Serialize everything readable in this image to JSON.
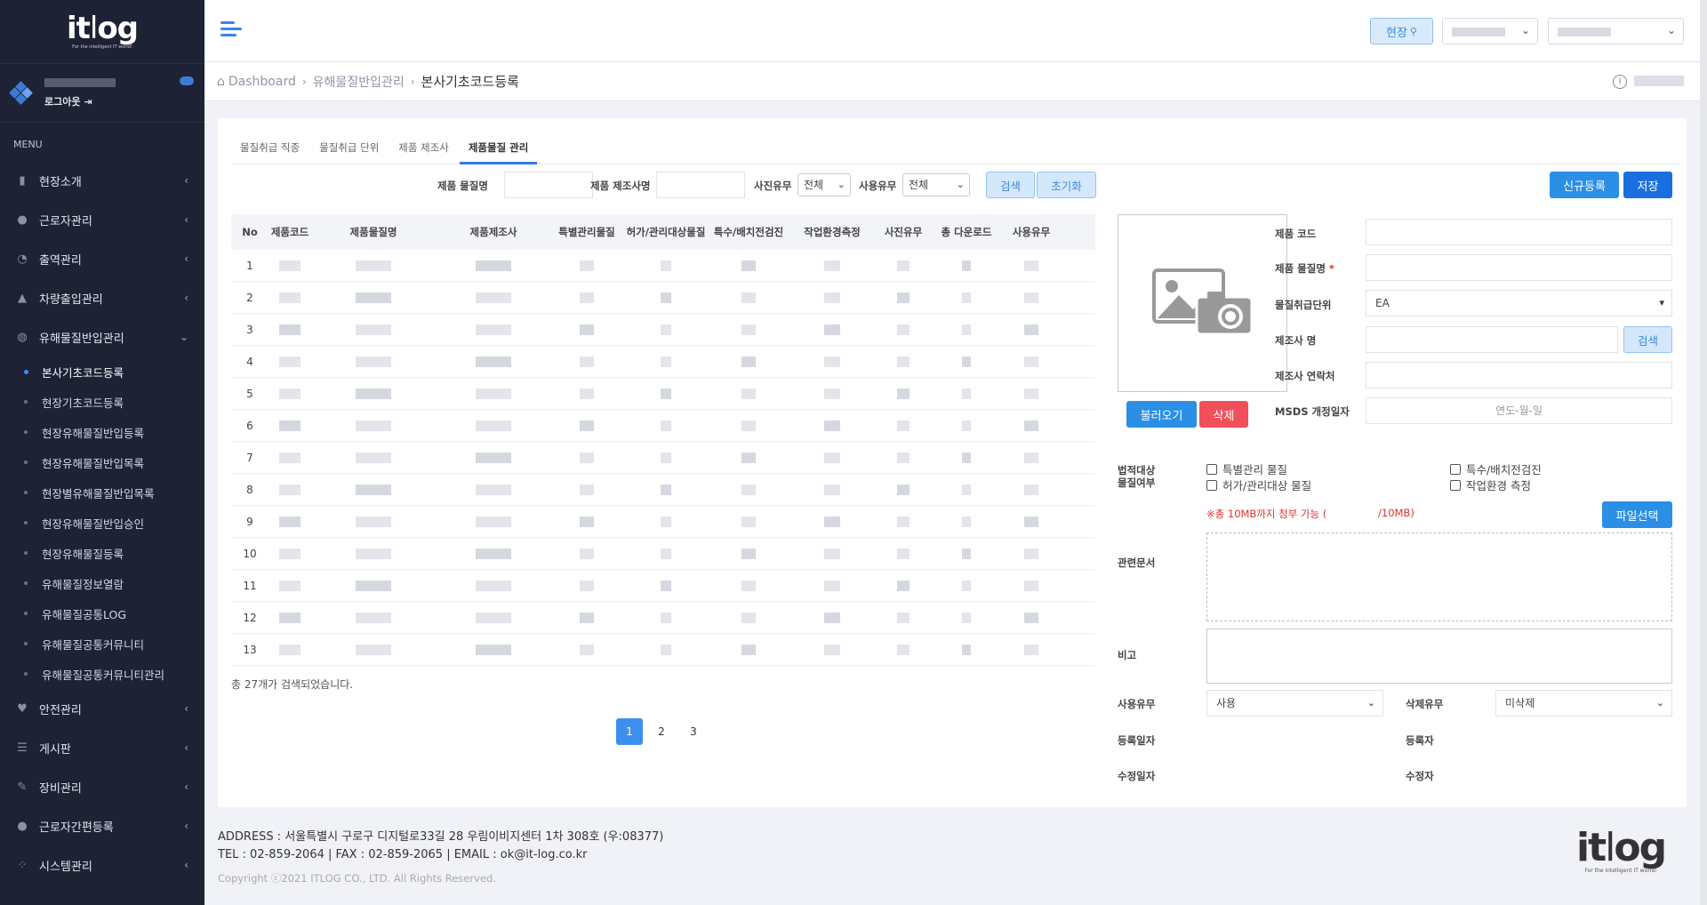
{
  "logo": {
    "main": "itlog",
    "sub": "For the intelligent IT world!"
  },
  "sidebar": {
    "logout": "로그아웃",
    "menu_head": "MENU",
    "items": [
      {
        "label": "현장소개",
        "icon": "building-icon"
      },
      {
        "label": "근로자관리",
        "icon": "user-icon"
      },
      {
        "label": "출역관리",
        "icon": "pie-icon"
      },
      {
        "label": "차량출입관리",
        "icon": "graduation-icon"
      },
      {
        "label": "유해물질반입관리",
        "icon": "flask-icon"
      }
    ],
    "sub_items": [
      "본사기초코드등록",
      "현장기초코드등록",
      "현장유해물질반입등록",
      "현장유해물질반입목록",
      "현장별유해물질반입목록",
      "현장유해물질반입승인",
      "현장유해물질등록",
      "유해물질정보열람",
      "유해물질공통LOG",
      "유해물질공통커뮤니티",
      "유해물질공통커뮤니티관리"
    ],
    "items_after": [
      {
        "label": "안전관리",
        "icon": "heart-icon"
      },
      {
        "label": "게시판",
        "icon": "list-icon"
      },
      {
        "label": "장비관리",
        "icon": "wrench-icon"
      },
      {
        "label": "근로자간편등록",
        "icon": "users-icon"
      },
      {
        "label": "시스템관리",
        "icon": "nodes-icon"
      }
    ]
  },
  "topbar": {
    "site_button": "현장"
  },
  "breadcrumb": {
    "home": "Dashboard",
    "parent": "유해물질반입관리",
    "current": "본사기초코드등록"
  },
  "tabs": [
    "물질취급 직종",
    "물질취급 단위",
    "제품 제조사",
    "제품물질 관리"
  ],
  "filter": {
    "product_name_label": "제품 물질명",
    "maker_label": "제품 제조사명",
    "photo_label": "사진유무",
    "photo_value": "전체",
    "use_label": "사용유무",
    "use_value": "전체",
    "search_btn": "검색",
    "reset_btn": "초기화"
  },
  "actions": {
    "new_btn": "신규등록",
    "save_btn": "저장"
  },
  "table": {
    "headers": [
      "No",
      "제품코드",
      "제품물질명",
      "제품제조사",
      "특별관리물질",
      "허가/관리대상물질",
      "특수/배치전검진",
      "작업환경측정",
      "사진유무",
      "총 다운로드",
      "사용유무"
    ],
    "rows": [
      "1",
      "2",
      "3",
      "4",
      "5",
      "6",
      "7",
      "8",
      "9",
      "10",
      "11",
      "12",
      "13"
    ],
    "count_text": "총 27개가 검색되었습니다."
  },
  "pagination": [
    "1",
    "2",
    "3"
  ],
  "form": {
    "load_btn": "불러오기",
    "delete_btn": "삭제",
    "code_label": "제품 코드",
    "name_label": "제품 물질명",
    "req_mark": "*",
    "unit_label": "물질취급단위",
    "unit_value": "EA",
    "maker_label": "제조사 명",
    "maker_search_btn": "검색",
    "contact_label": "제조사 연락처",
    "msds_label": "MSDS 개정일자",
    "msds_placeholder": "연도-월-일",
    "legal_label_1": "법적대상",
    "legal_label_2": "물질여부",
    "chk_special": "특별관리 물질",
    "chk_permit": "허가/관리대상 물질",
    "chk_exam": "특수/배치전검진",
    "chk_env": "작업환경 측정",
    "file_warn_a": "※총 10MB까지 첨부 가능 (",
    "file_warn_b": "/10MB)",
    "file_btn": "파일선택",
    "doc_label": "관련문서",
    "note_label": "비고",
    "use_label": "사용유무",
    "use_value": "사용",
    "del_label": "삭제유무",
    "del_value": "미삭제",
    "reg_date_label": "등록일자",
    "reg_user_label": "등록자",
    "mod_date_label": "수정일자",
    "mod_user_label": "수정자"
  },
  "footer": {
    "address": "ADDRESS : 서울특별시 구로구 디지털로33길 28 우림이비지센터 1차 308호 (우:08377)",
    "contact": "TEL : 02-859-2064 | FAX : 02-859-2065 | EMAIL : ok@it-log.co.kr",
    "copyright": "Copyright ⓒ2021 ITLOG CO., LTD. All Rights Reserved."
  },
  "colors": {
    "sidebar_bg": "#1e2235",
    "accent": "#2f7ce0",
    "danger": "#f0505a",
    "light_button": "#d4e8fb"
  }
}
